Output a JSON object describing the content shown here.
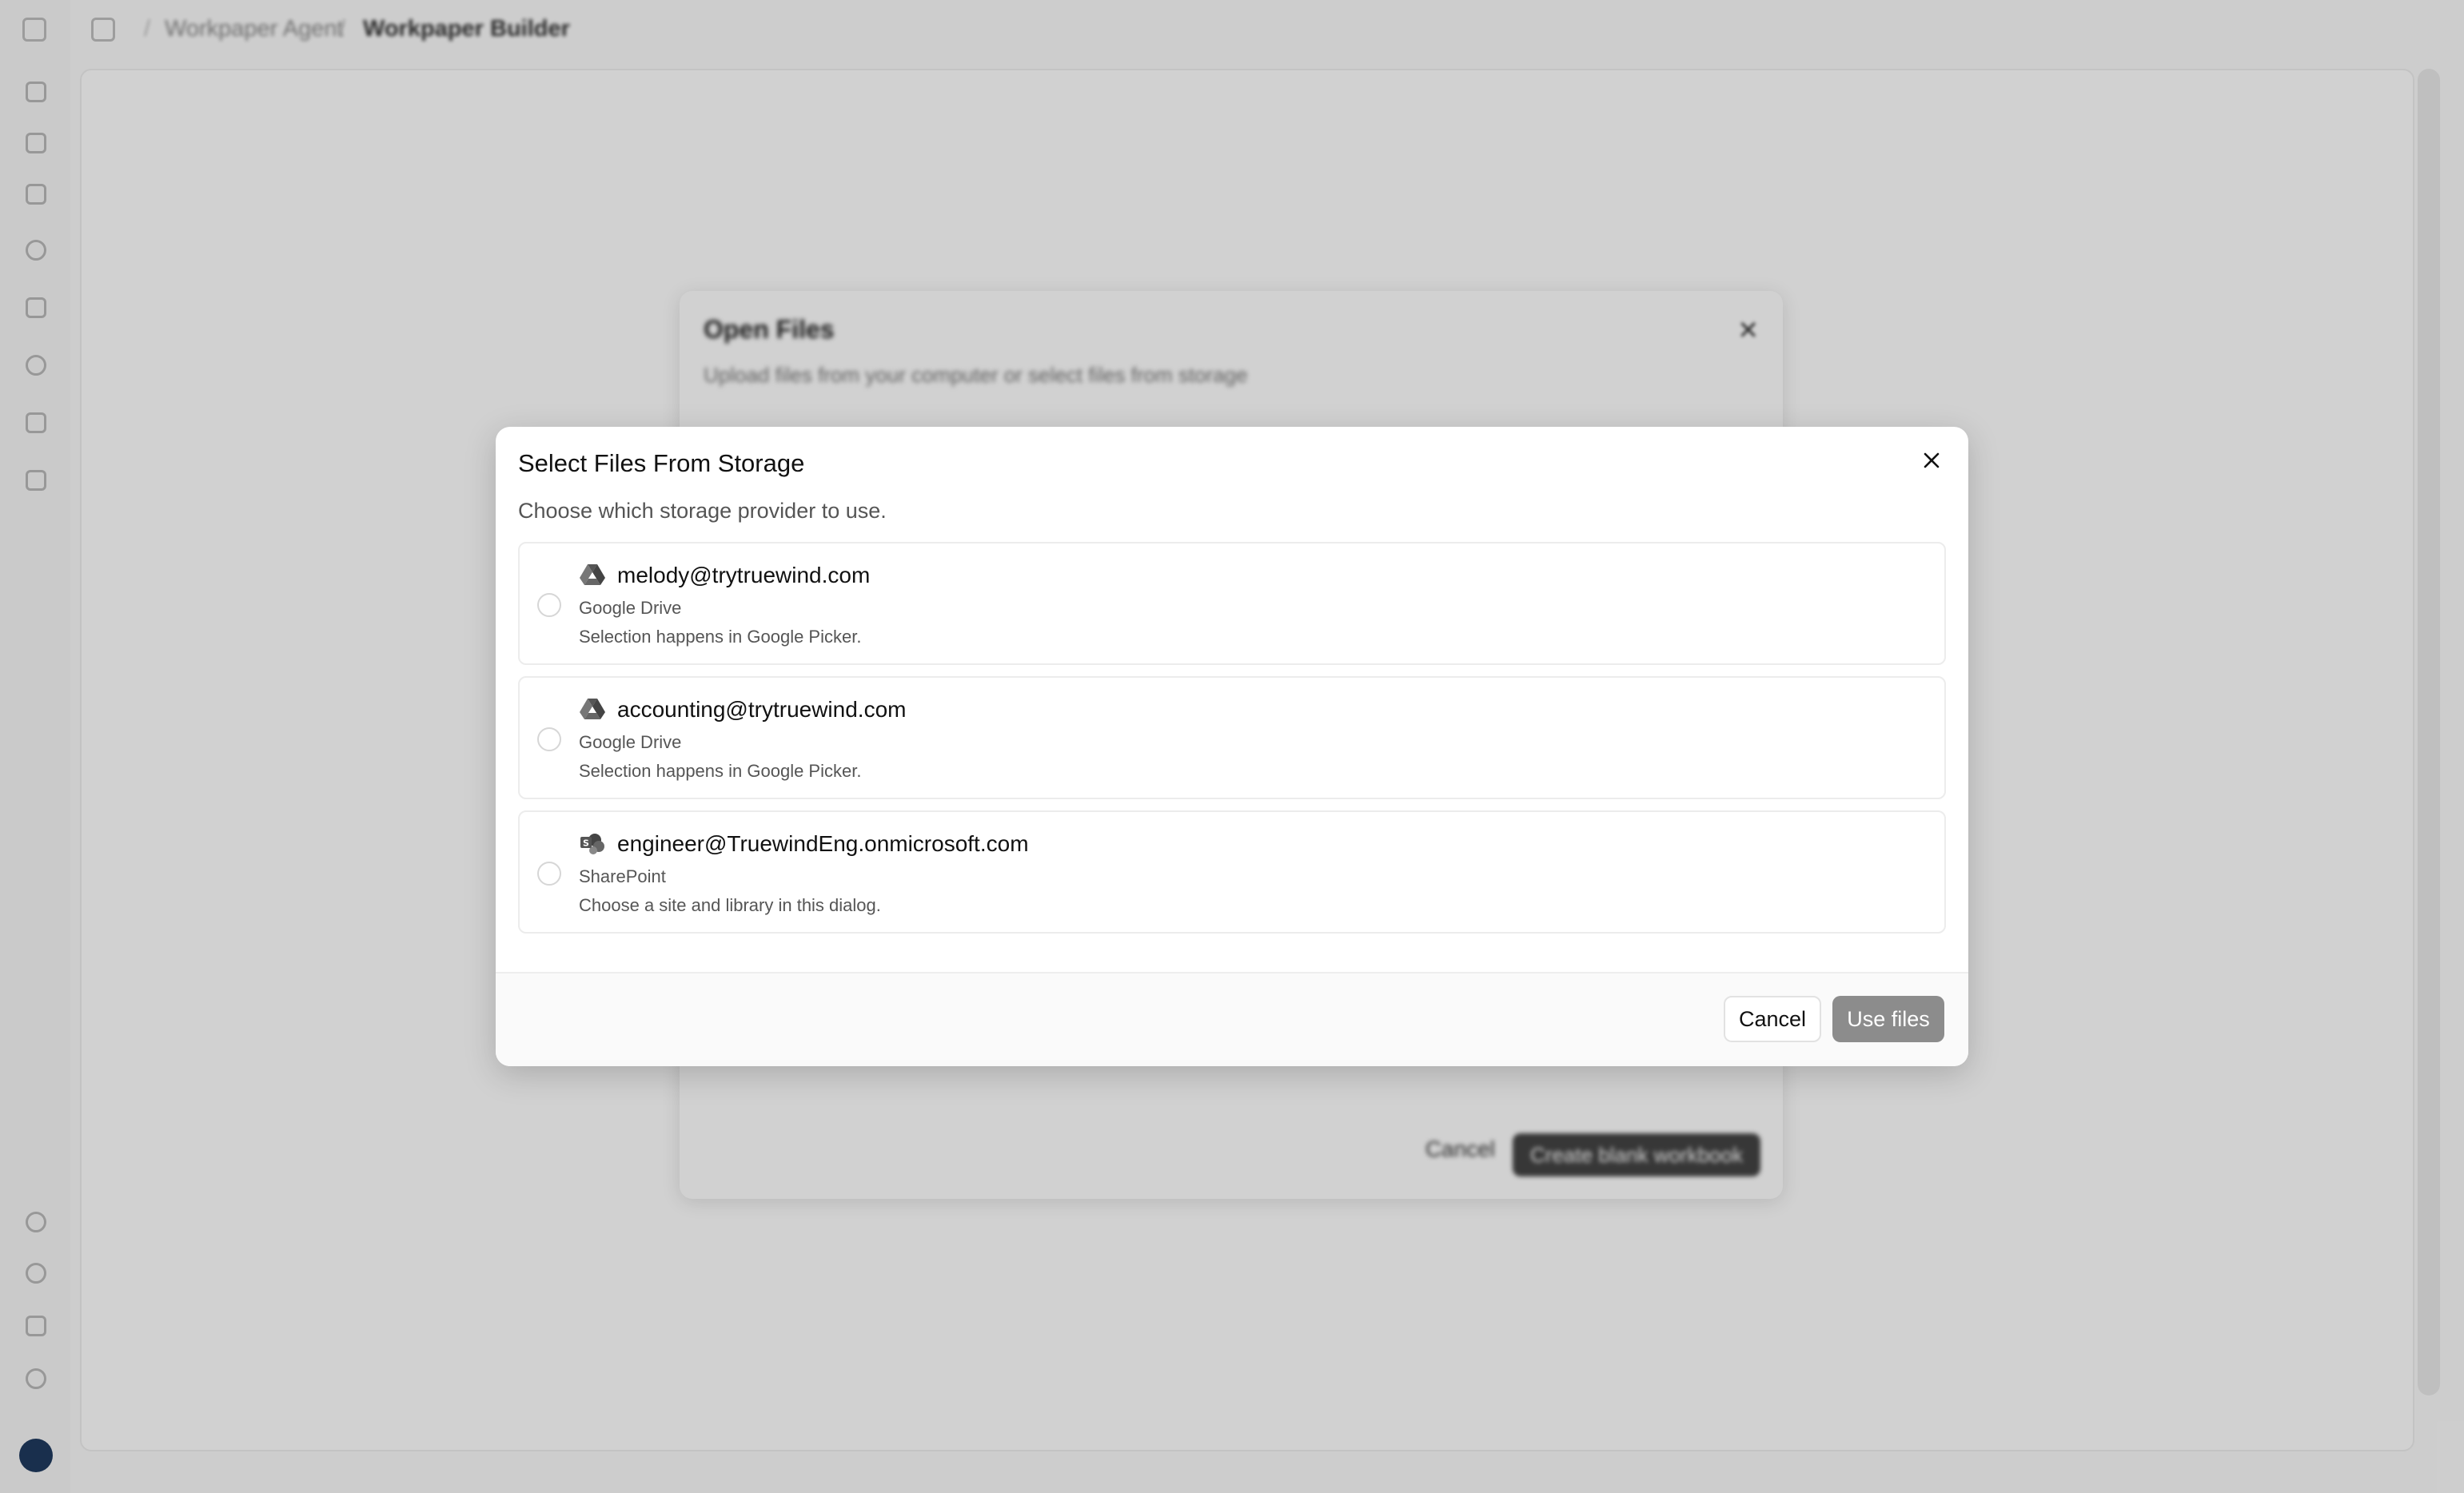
{
  "breadcrumb": {
    "parent": "Workpaper Agent",
    "current": "Workpaper Builder"
  },
  "back_dialog": {
    "title": "Open Files",
    "subtitle": "Upload files from your computer or select files from storage",
    "cancel_label": "Cancel",
    "create_label": "Create blank workbook"
  },
  "modal": {
    "title": "Select Files From Storage",
    "subtitle": "Choose which storage provider to use.",
    "providers": [
      {
        "account": "melody@trytruewind.com",
        "type": "Google Drive",
        "description": "Selection happens in Google Picker.",
        "icon": "google-drive-icon"
      },
      {
        "account": "accounting@trytruewind.com",
        "type": "Google Drive",
        "description": "Selection happens in Google Picker.",
        "icon": "google-drive-icon"
      },
      {
        "account": "engineer@TruewindEng.onmicrosoft.com",
        "type": "SharePoint",
        "description": "Choose a site and library in this dialog.",
        "icon": "sharepoint-icon"
      }
    ],
    "cancel_label": "Cancel",
    "use_label": "Use files"
  },
  "colors": {
    "primary_disabled": "#8c8c8c",
    "overlay": "rgba(0,0,0,0.18)",
    "border": "#ececec"
  }
}
